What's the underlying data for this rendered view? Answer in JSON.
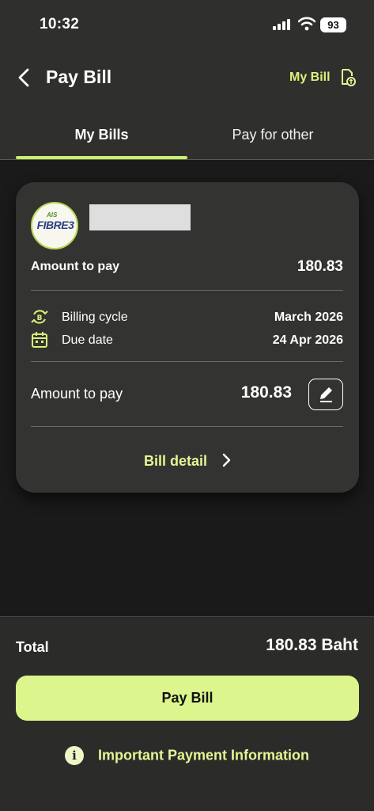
{
  "status_bar": {
    "time": "10:32",
    "battery": "93"
  },
  "header": {
    "title": "Pay Bill",
    "my_bill_link": "My Bill"
  },
  "tabs": [
    {
      "label": "My Bills",
      "active": true
    },
    {
      "label": "Pay for other",
      "active": false
    }
  ],
  "bill_card": {
    "provider_logo_text": "FIBRE3",
    "provider_logo_ais": "AIS",
    "amount_label": "Amount to pay",
    "amount_value": "180.83",
    "billing_cycle_label": "Billing cycle",
    "billing_cycle_value": "March 2026",
    "due_date_label": "Due date",
    "due_date_value": "24 Apr 2026",
    "edit_amount_label": "Amount to pay",
    "edit_amount_value": "180.83",
    "bill_detail_link": "Bill detail"
  },
  "footer": {
    "total_label": "Total",
    "total_value": "180.83 Baht",
    "pay_button": "Pay Bill",
    "info_link": "Important Payment Information"
  },
  "colors": {
    "accent": "#dcf58c",
    "link": "#e4f693",
    "background": "#1a1a1a",
    "card": "#333332"
  }
}
